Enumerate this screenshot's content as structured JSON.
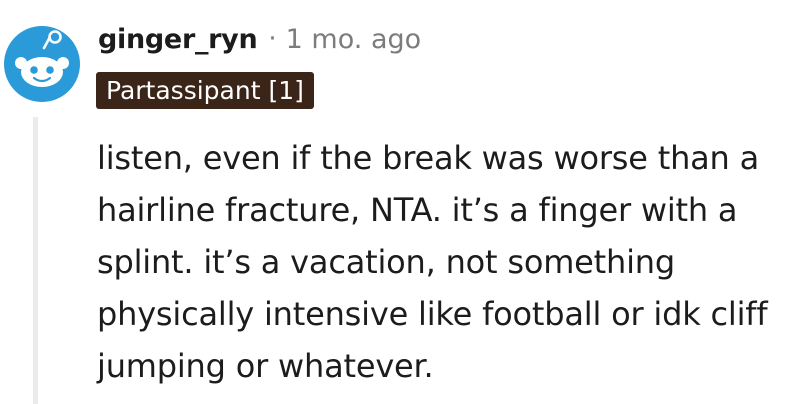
{
  "comment": {
    "username": "ginger_ryn",
    "separator": "·",
    "timestamp": "1 mo. ago",
    "flair": "Partassipant [1]",
    "body": "listen, even if the break was worse than a hairline fracture, NTA. it’s a finger with a splint. it’s a vacation, not something physically intensive like football or idk cliff jumping or whatever.",
    "avatar_icon": "reddit-snoo-avatar-icon"
  },
  "colors": {
    "text": "#1c1c1c",
    "meta_gray": "#7c7c7c",
    "flair_bg": "#3b2418",
    "flair_text": "#ffffff",
    "avatar_blue": "#2a9bd8",
    "thread_line": "#e9ebed"
  }
}
